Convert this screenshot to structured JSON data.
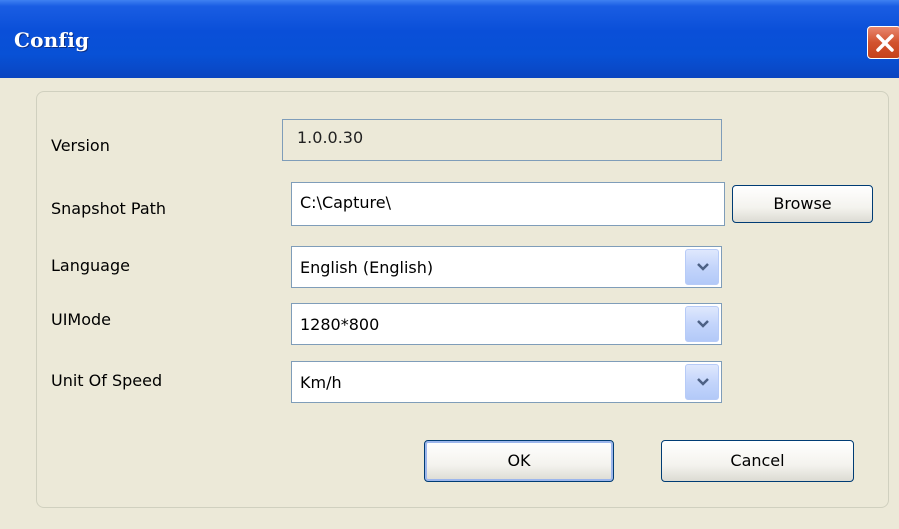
{
  "window": {
    "title": "Config"
  },
  "fields": {
    "version": {
      "label": "Version",
      "value": "1.0.0.30"
    },
    "snapshot_path": {
      "label": "Snapshot Path",
      "value": "C:\\Capture\\",
      "browse_label": "Browse"
    },
    "language": {
      "label": "Language",
      "value": "English (English)"
    },
    "ui_mode": {
      "label": "UIMode",
      "value": "1280*800"
    },
    "unit_of_speed": {
      "label": "Unit Of Speed",
      "value": "Km/h"
    }
  },
  "buttons": {
    "ok": "OK",
    "cancel": "Cancel"
  },
  "icons": {
    "close": "close-icon",
    "dropdown": "chevron-down-icon"
  },
  "colors": {
    "title_bar": "#0a4fd8",
    "close_button": "#d2522e",
    "dialog_bg": "#ece9d8"
  }
}
